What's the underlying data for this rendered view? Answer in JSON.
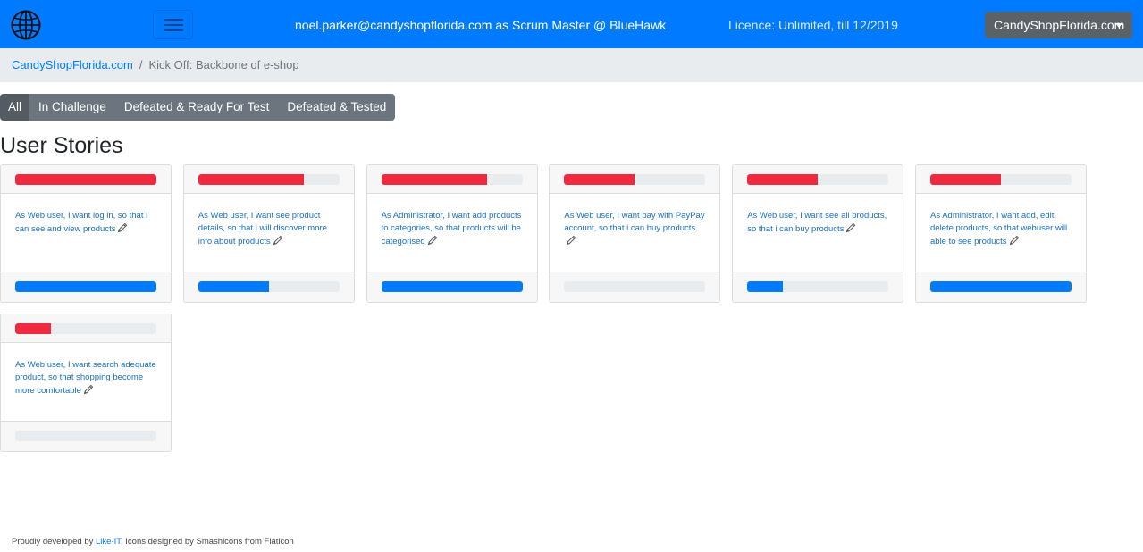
{
  "navbar": {
    "user_text": "noel.parker@candyshopflorida.com as Scrum Master @ BlueHawk",
    "licence_text": "Licence: Unlimited, till 12/2019",
    "org_button": "CandyShopFlorida.com",
    "menu_icon": "hamburger-icon",
    "logo_icon": "globe-icon"
  },
  "breadcrumb": {
    "home": "CandyShopFlorida.com",
    "separator": "/",
    "current": "Kick Off: Backbone of e-shop"
  },
  "filters": [
    "All",
    "In Challenge",
    "Defeated & Ready For Test",
    "Defeated & Tested"
  ],
  "active_filter": "All",
  "page_title": "User Stories",
  "colors": {
    "primary": "#007bff",
    "danger": "#f0293e",
    "secondary": "#6c757d"
  },
  "stories": [
    {
      "text": "As Web user, I want log in, so that i can see and view products",
      "top_progress": 1.0,
      "bottom_progress": 1.0
    },
    {
      "text": "As Web user, I want see product details, so that i will discover more info about products",
      "top_progress": 0.75,
      "bottom_progress": 0.5
    },
    {
      "text": "As Administrator, I want add products to categories, so that products will be categorised",
      "top_progress": 0.75,
      "bottom_progress": 1.0
    },
    {
      "text": "As Web user, I want pay with PayPay account, so that i can buy products",
      "top_progress": 0.5,
      "bottom_progress": 0.0
    },
    {
      "text": "As Web user, I want see all products, so that i can buy products",
      "top_progress": 0.5,
      "bottom_progress": 0.25
    },
    {
      "text": "As Administrator, I want add, edit, delete products, so that webuser will able to see products",
      "top_progress": 0.5,
      "bottom_progress": 1.0
    },
    {
      "text": "As Web user, I want search adequate product, so that shopping become more comfortable",
      "top_progress": 0.25,
      "bottom_progress": 0.0
    }
  ],
  "footer": {
    "prefix": "Proudly developed by ",
    "link": "Like-IT",
    "suffix": ". Icons designed by Smashicons from Flaticon"
  }
}
